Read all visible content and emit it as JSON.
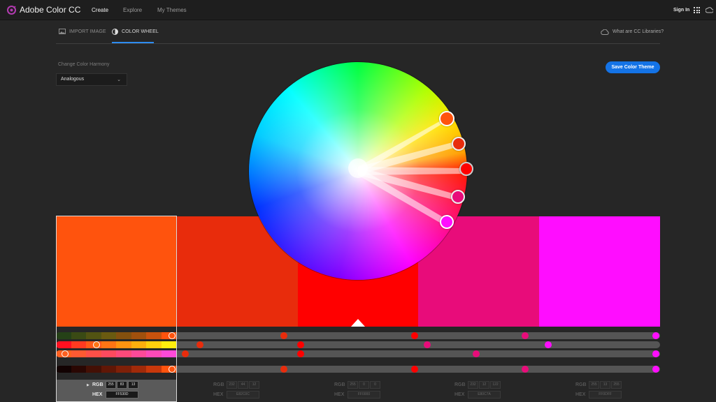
{
  "app": {
    "title": "Adobe Color CC"
  },
  "nav": {
    "create": "Create",
    "explore": "Explore",
    "my_themes": "My Themes",
    "sign_in": "Sign In"
  },
  "tabs": {
    "import_image": "IMPORT IMAGE",
    "color_wheel": "COLOR WHEEL",
    "libraries": "What are CC Libraries?"
  },
  "harmony": {
    "label": "Change Color Harmony",
    "selected": "Analogous"
  },
  "save_button": "Save Color Theme",
  "swatches": [
    {
      "color": "#FF530D",
      "rgb": [
        "255",
        "83",
        "13"
      ],
      "hex": "FF530D",
      "selected": true
    },
    {
      "color": "#E82C0C",
      "rgb": [
        "232",
        "44",
        "12"
      ],
      "hex": "E82C0C",
      "selected": false
    },
    {
      "color": "#FF0000",
      "rgb": [
        "255",
        "0",
        "0"
      ],
      "hex": "FF0000",
      "selected": false
    },
    {
      "color": "#E80C7A",
      "rgb": [
        "232",
        "12",
        "122"
      ],
      "hex": "E80C7A",
      "selected": false
    },
    {
      "color": "#FF0DFF",
      "rgb": [
        "255",
        "13",
        "255"
      ],
      "hex": "FF0DFF",
      "selected": false
    }
  ],
  "labels": {
    "rgb": "RGB",
    "hex": "HEX"
  },
  "colors": {
    "accent": "#1473e6",
    "active_tab": "#2d8cf0",
    "background": "#262626"
  }
}
